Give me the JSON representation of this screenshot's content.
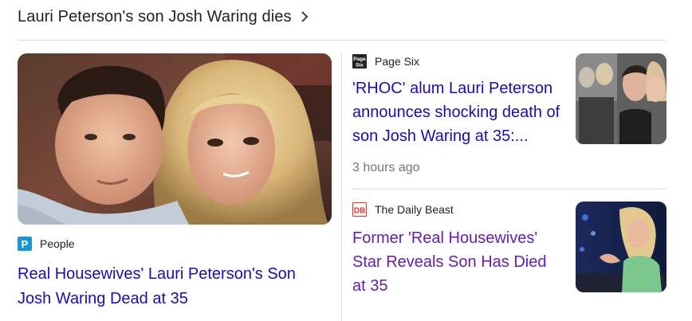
{
  "header": {
    "title": "Lauri Peterson's son Josh Waring dies"
  },
  "left_card": {
    "source": "People",
    "source_icon": "people-logo-icon",
    "source_color": "#1a95d5",
    "headline": "Real Housewives' Lauri Peterson's Son Josh Waring Dead at 35"
  },
  "stories": [
    {
      "source": "Page Six",
      "source_icon": "page-six-logo-icon",
      "headline": "'RHOC' alum Lauri Peterson announces shocking death of son Josh Waring at 35:...",
      "time": "3 hours ago"
    },
    {
      "source": "The Daily Beast",
      "source_icon": "daily-beast-logo-icon",
      "source_color": "#e4322b",
      "headline": "Former 'Real Housewives' Star Reveals Son Has Died at 35"
    }
  ],
  "colors": {
    "link": "#1a0dab",
    "visited_link": "#681da8",
    "meta": "#70757a"
  }
}
